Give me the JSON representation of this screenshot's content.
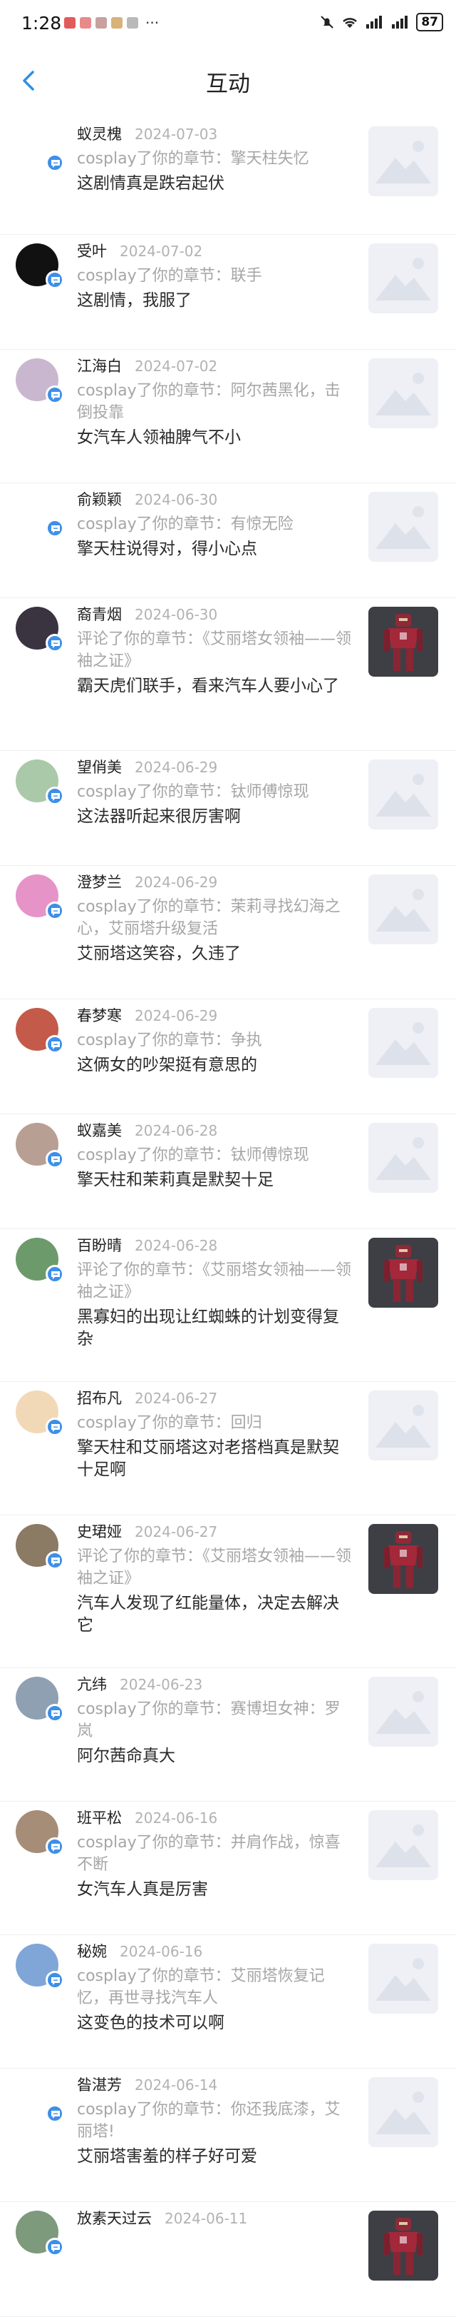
{
  "status_bar": {
    "time": "1:28",
    "dots": "···",
    "battery": "87"
  },
  "header": {
    "title": "互动"
  },
  "items": [
    {
      "name": "蚁灵槐",
      "date": "2024-07-03",
      "action": "cosplay了你的章节：擎天柱失忆",
      "comment": "这剧情真是跌宕起伏",
      "avatar_color": "#ffffff",
      "thumb": "placeholder"
    },
    {
      "name": "受叶",
      "date": "2024-07-02",
      "action": "cosplay了你的章节：联手",
      "comment": "这剧情，我服了",
      "avatar_color": "#111111",
      "thumb": "placeholder"
    },
    {
      "name": "江海白",
      "date": "2024-07-02",
      "action": "cosplay了你的章节：阿尔茜黑化，击倒投靠",
      "comment": "女汽车人领袖脾气不小",
      "avatar_color": "#c9b7cf",
      "thumb": "placeholder"
    },
    {
      "name": "俞颖颖",
      "date": "2024-06-30",
      "action": "cosplay了你的章节：有惊无险",
      "comment": "擎天柱说得对，得小心点",
      "avatar_color": "#ffffff",
      "thumb": "placeholder"
    },
    {
      "name": "裔青烟",
      "date": "2024-06-30",
      "action": "评论了你的章节：《艾丽塔女领袖——领袖之证》",
      "comment": "霸天虎们联手，看来汽车人要小心了",
      "avatar_color": "#3a3340",
      "thumb": "robot"
    },
    {
      "name": "望俏美",
      "date": "2024-06-29",
      "action": "cosplay了你的章节：钛师傅惊现",
      "comment": "这法器听起来很厉害啊",
      "avatar_color": "#a9c9a8",
      "thumb": "placeholder"
    },
    {
      "name": "澄梦兰",
      "date": "2024-06-29",
      "action": "cosplay了你的章节：茉莉寻找幻海之心，艾丽塔升级复活",
      "comment": "艾丽塔这笑容，久违了",
      "avatar_color": "#e693c8",
      "thumb": "placeholder"
    },
    {
      "name": "春梦寒",
      "date": "2024-06-29",
      "action": "cosplay了你的章节：争执",
      "comment": "这俩女的吵架挺有意思的",
      "avatar_color": "#c45a4a",
      "thumb": "placeholder"
    },
    {
      "name": "蚁嘉美",
      "date": "2024-06-28",
      "action": "cosplay了你的章节：钛师傅惊现",
      "comment": "擎天柱和茉莉真是默契十足",
      "avatar_color": "#b89f94",
      "thumb": "placeholder"
    },
    {
      "name": "百盼晴",
      "date": "2024-06-28",
      "action": "评论了你的章节：《艾丽塔女领袖——领袖之证》",
      "comment": "黑寡妇的出现让红蜘蛛的计划变得复杂",
      "avatar_color": "#6d9a6b",
      "thumb": "robot"
    },
    {
      "name": "招布凡",
      "date": "2024-06-27",
      "action": "cosplay了你的章节：回归",
      "comment": "擎天柱和艾丽塔这对老搭档真是默契十足啊",
      "avatar_color": "#f1d9b8",
      "thumb": "placeholder"
    },
    {
      "name": "史珺娅",
      "date": "2024-06-27",
      "action": "评论了你的章节：《艾丽塔女领袖——领袖之证》",
      "comment": "汽车人发现了红能量体，决定去解决它",
      "avatar_color": "#8b7a64",
      "thumb": "robot"
    },
    {
      "name": "亢纬",
      "date": "2024-06-23",
      "action": "cosplay了你的章节：赛博坦女神：罗岚",
      "comment": "阿尔茜命真大",
      "avatar_color": "#8fa0b3",
      "thumb": "placeholder"
    },
    {
      "name": "班平松",
      "date": "2024-06-16",
      "action": "cosplay了你的章节：并肩作战，惊喜不断",
      "comment": "女汽车人真是厉害",
      "avatar_color": "#a58d78",
      "thumb": "placeholder"
    },
    {
      "name": "秘婉",
      "date": "2024-06-16",
      "action": "cosplay了你的章节：艾丽塔恢复记忆，再世寻找汽车人",
      "comment": "这变色的技术可以啊",
      "avatar_color": "#7fa6d6",
      "thumb": "placeholder"
    },
    {
      "name": "昝湛芳",
      "date": "2024-06-14",
      "action": "cosplay了你的章节：你还我底漆，艾丽塔!",
      "comment": "艾丽塔害羞的样子好可爱",
      "avatar_color": "#ffffff",
      "thumb": "placeholder"
    },
    {
      "name": "放素天过云",
      "date": "2024-06-11",
      "action": "",
      "comment": "",
      "avatar_color": "#7d9a7c",
      "thumb": "robot"
    }
  ]
}
